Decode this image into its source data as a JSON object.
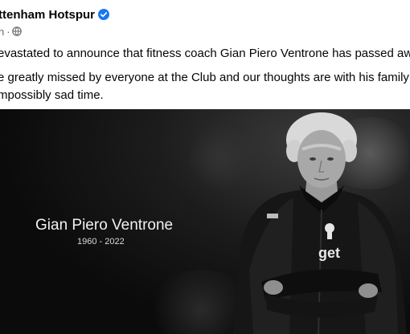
{
  "post": {
    "author": "ttenham Hotspur",
    "timestamp": "h",
    "separator": "·",
    "paragraphs": [
      "evastated to announce that fitness coach Gian Piero Ventrone has passed away",
      "e greatly missed by everyone at the Club and our thoughts are with his family a",
      "mpossibly sad time."
    ]
  },
  "image": {
    "tribute_name": "Gian Piero Ventrone",
    "tribute_years": "1960 - 2022",
    "jacket_text": "get"
  },
  "icons": {
    "verified": "verified-badge-icon",
    "audience": "globe-icon"
  },
  "colors": {
    "verified_blue": "#1877f2",
    "text_primary": "#050505",
    "text_secondary": "#65676b"
  }
}
